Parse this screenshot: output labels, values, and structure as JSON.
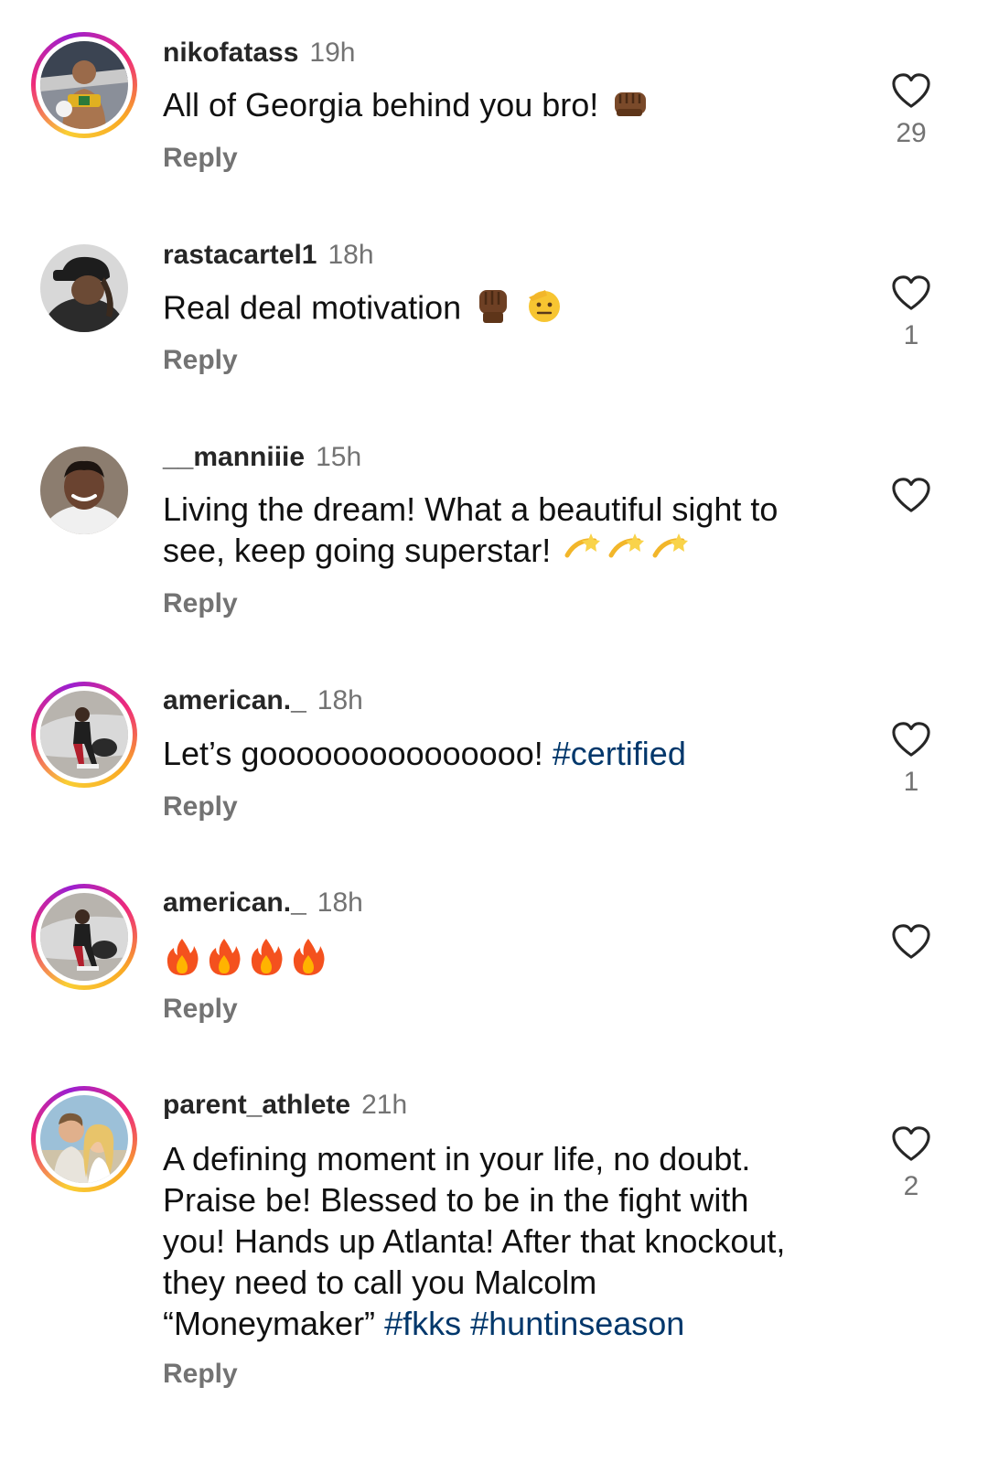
{
  "comments": [
    {
      "username": "nikofatass",
      "time": "19h",
      "text": "All of Georgia behind you bro!",
      "emojis": [
        "fist-bump-emoji"
      ],
      "reply_label": "Reply",
      "likes": "29",
      "has_story_ring": true
    },
    {
      "username": "rastacartel1",
      "time": "18h",
      "text": "Real deal motivation",
      "emojis": [
        "raised-fist-emoji",
        "saluting-face-emoji"
      ],
      "reply_label": "Reply",
      "likes": "1",
      "has_story_ring": false
    },
    {
      "username": "__manniiie",
      "time": "15h",
      "text_lines": [
        "Living the dream! What a beautiful sight to",
        "see, keep going superstar!"
      ],
      "emojis": [
        "dizzy-emoji",
        "dizzy-emoji",
        "dizzy-emoji"
      ],
      "reply_label": "Reply",
      "likes": "",
      "has_story_ring": false
    },
    {
      "username": "american._",
      "time": "18h",
      "text": "Let’s gooooooooooooooo!",
      "hashtag": "#certified",
      "reply_label": "Reply",
      "likes": "1",
      "has_story_ring": true
    },
    {
      "username": "american._",
      "time": "18h",
      "emojis": [
        "fire-emoji",
        "fire-emoji",
        "fire-emoji",
        "fire-emoji"
      ],
      "reply_label": "Reply",
      "likes": "",
      "has_story_ring": true
    },
    {
      "username": "parent_athlete",
      "time": "21h",
      "text_lines": [
        "A defining moment in your life,  no doubt.",
        "Praise be! Blessed to be in the fight with",
        "you! Hands up Atlanta! After that knockout,",
        "they need to call you Malcolm",
        "“Moneymaker”"
      ],
      "hashtags": [
        "#fkks",
        "#huntinseason"
      ],
      "reply_label": "Reply",
      "likes": "2",
      "has_story_ring": true
    }
  ],
  "colors": {
    "hashtag": "#00376b",
    "muted": "#737373",
    "username": "#262626"
  },
  "icons": {
    "like": "heart-outline-icon"
  }
}
